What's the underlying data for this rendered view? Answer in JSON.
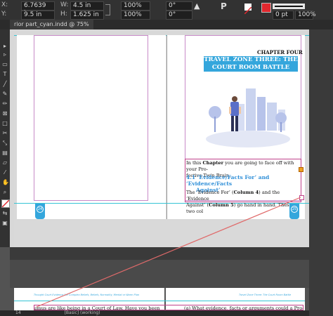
{
  "control": {
    "x_value": "6.7639 in",
    "y_value": "9.5 in",
    "w_value": "4.5 in",
    "h_value": "1.625 in",
    "scale_x": "100%",
    "scale_y": "100%",
    "angle_1": "0°",
    "angle_2": "0°",
    "stroke_weight": "0 pt",
    "opacity": "100%",
    "x_label": "X:",
    "y_label": "Y:",
    "w_label": "W:",
    "h_label": "H:"
  },
  "tab": {
    "title": "rior part_cyan.indd @ 75%",
    "close": "×"
  },
  "page": {
    "chapter_label": "CHAPTER FOUR",
    "banner_line1": "TRAVEL ZONE THREE: THE",
    "banner_line2": "COURT ROOM BATTLE",
    "intro_prefix": "In this ",
    "intro_bold": "Chapter",
    "intro_rest": " you are going to face off with your Pro-",
    "intro_line2": "fective Twin Brain.",
    "heading_line1": "4.1   ‘Evidence/Facts For’ and ‘Evidence/Facts",
    "heading_line2": "Against’",
    "para_line1_a": "The ‘Evidence For’ (",
    "para_line1_bold": "Column 4",
    "para_line1_b": ") and the ‘Evidence",
    "para_line2_a": "Against’ (",
    "para_line2_bold": "Column 5",
    "para_line2_b": ") go hand in hand. These two col",
    "left_page_num": "24",
    "right_page_num": "25"
  },
  "lower_spread": {
    "left_header": "Thought Court Evidence For Complex Beliefs, Beliefs, Normality, Mental or Warm Plan",
    "right_header": "Travel Zone Three: The Court Room Battle",
    "left_text": "umus are like being in a Court of Law. Have you been",
    "right_text": "(a)    What evidence, facts or arguments could a Pro-"
  },
  "status": {
    "page_indicator": "14",
    "style_label": "[Basic] (working)"
  },
  "colors": {
    "accent": "#34a6dc",
    "thread": "#e06a6a",
    "frame": "#c0408a"
  }
}
